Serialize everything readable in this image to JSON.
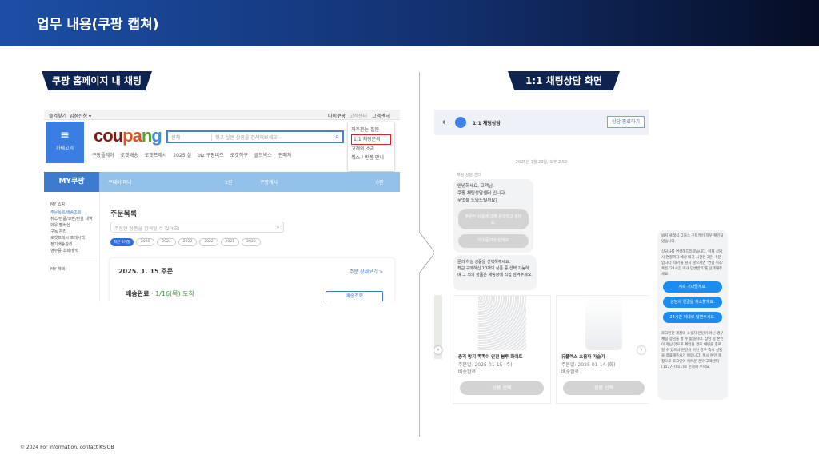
{
  "slide": {
    "title": "업무 내용(쿠팡 캡쳐)",
    "footer": "© 2024 For information, contact KSJOB"
  },
  "tags": {
    "left": "쿠팡 홈페이지 내 채팅",
    "right": "1:1 채팅상담 화면"
  },
  "coupang": {
    "top_links": [
      "즐겨찾기",
      "입점신청 ▾"
    ],
    "top_right": [
      "마이쿠팡",
      "고객센터"
    ],
    "top_menu": "고객센터",
    "category_label": "카테고리",
    "logo": "coupang",
    "search_category": "전체",
    "search_placeholder": "찾고 싶은 상품을 검색해보세요!",
    "quick_links": [
      "쿠팡플레이",
      "로켓배송",
      "로켓프레시",
      "2025 설",
      "biz 쿠팡비즈",
      "로켓직구",
      "골드박스",
      "판매자"
    ],
    "dropdown": [
      "자주묻는 질문",
      "1:1 채팅문의",
      "고객의 소리",
      "취소 / 반품 안내"
    ],
    "my_title": "MY쿠팡",
    "cash_labels": [
      "쿠페이 머니",
      "쿠팡캐시"
    ],
    "cash_values": [
      "1원",
      "0원"
    ],
    "side_heading": "MY 쇼핑",
    "side_items": [
      "주문목록/배송조회",
      "취소/반품/교환/환불 내역",
      "와우 멤버십",
      "구독 관리",
      "로켓프레시 프레시백",
      "정기배송관리",
      "영수증 조회/출력"
    ],
    "side_heading2": "MY 혜택",
    "order_title": "주문목록",
    "order_search_placeholder": "주문한 상품을 검색할 수 있어요!",
    "year_filters": [
      "최근 6개월",
      "2025",
      "2024",
      "2023",
      "2022",
      "2021",
      "2020"
    ],
    "order_date": "2025. 1. 15 주문",
    "order_detail_link": "주문 상세보기 >",
    "delivery_status": "배송완료",
    "delivery_date": " · 1/16(목) 도착",
    "track_button": "배송조회"
  },
  "chat": {
    "title": "1:1 채팅상담",
    "end_button": "상담 종료하기",
    "timestamp": "2025년 1월 23일, 오후 2:52",
    "sender": "채팅 상담 센터",
    "greeting": "안녕하세요, 고객님.\n쿠팡 채팅상담센터 입니다.\n무엇을 도와드릴까요?",
    "option1": "주문한 상품에 대해 문의하고 싶어요.",
    "option2": "기타 문의가 있어요.",
    "select_prompt": "문의 하실 상품을 선택해주세요.\n최근 구매하신 10개의 상품 중 선택 가능하며 그 외의 상품은 채팅창에 직접 남겨주세요.",
    "products": [
      {
        "name": "충격 방지 뽁뽁이 안전 봉투 화이트",
        "date": "주문일: 2025-01-15 (수)",
        "status": "배송완료",
        "button": "상품 선택"
      },
      {
        "name": "듀플렉스 초음파 가습기",
        "date": "주문일: 2025-01-14 (화)",
        "status": "배송완료",
        "button": "상품 선택"
      }
    ],
    "side_msg1": "봐지 클래식 그물스 구트케어 지우 확인되었습니다.",
    "side_msg2": "상담사를 연결해드리겠습니다. 현재 상담사 연결까지 예상 대기 시간은 3분~5분입니다. 대기를 원치 않으시면 '연결 취소' 혹은 '24시간 이내 답변받기'를 선택해주세요.",
    "side_buttons": [
      "계속 기다릴게요.",
      "상담사 연결을 취소할게요.",
      "24시간 이내로 답변주세요."
    ],
    "side_msg3": "로그인한 계정의 소유자 본인이 아닌 경우 채팅 상담을 할 수 없습니다. 상담 중 본인이 아닌 것으로 확인될 경우 채팅을 종료할 수 있으니 본인이 아닌 경우 즉시 상담을 종료해주시기 바랍니다. 혹시 본인 계정으로 로그인이 어려운 경우 고객센터 (1577-7011)로 문의해 주세요."
  }
}
